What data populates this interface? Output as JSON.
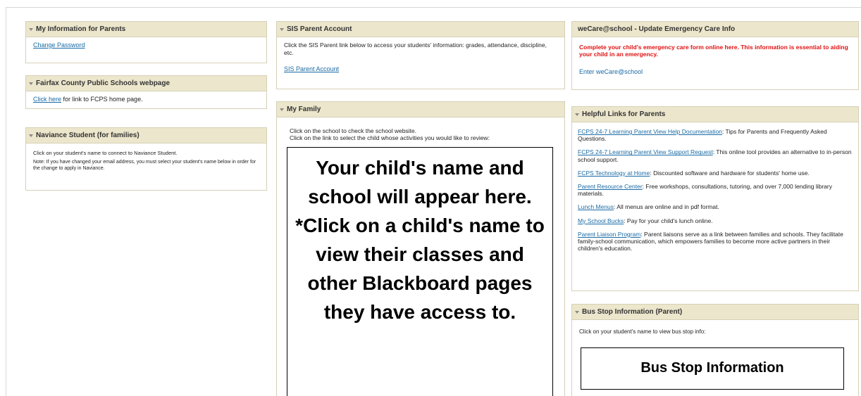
{
  "my_info": {
    "title": "My Information for Parents",
    "change_password": "Change Password"
  },
  "fcps_webpage": {
    "title": "Fairfax County Public Schools webpage",
    "click_here": "Click here",
    "text": " for link to FCPS home page."
  },
  "naviance": {
    "title": "Naviance Student (for families)",
    "line1": "Click on your student's name to connect to Naviance Student.",
    "note": "Note: If you have changed your email address, you must select your student's name below in order for the change to apply in Naviance."
  },
  "sis": {
    "title": "SIS Parent Account",
    "text": "Click the SIS Parent link below to access your students' information: grades, attendance, discipline, etc.",
    "link": "SIS Parent Account"
  },
  "family": {
    "title": "My Family",
    "line1": "Click on the school to check the school website.",
    "line2": "Click on the link to select the child whose activities you would like to review:",
    "overlay": "Your child's name and school will appear here. *Click on a child's name to view their classes and other Blackboard pages they have access to."
  },
  "wecare": {
    "title": "weCare@school - Update Emergency Care Info",
    "red_text": "Complete your child's emergency care form online here. This information is essential to aiding your child in an emergency.",
    "link": "Enter weCare@school"
  },
  "helpful": {
    "title": "Helpful Links for Parents",
    "items": [
      {
        "link": "FCPS 24-7 Learning Parent View Help Documentation",
        "text": ": Tips for Parents and Frequently Asked Questions."
      },
      {
        "link": "FCPS 24-7 Learning Parent View Support Request",
        "text": ": This online tool provides an alternative to in-person school support."
      },
      {
        "link": "FCPS Technology at Home",
        "text": ": Discounted software and hardware for students' home use."
      },
      {
        "link": "Parent Resource Center",
        "text": ": Free workshops, consultations, tutoring, and over 7,000 lending library materials."
      },
      {
        "link": "Lunch Menus",
        "text": ": All menus are online and in pdf format."
      },
      {
        "link": "My School Bucks",
        "text": ": Pay for your child's lunch online."
      },
      {
        "link": "Parent Liaison Program",
        "text": ": Parent liaisons serve as a link between families and schools. They facilitate family-school communication, which empowers families to become more active partners in their children's education."
      }
    ]
  },
  "bus": {
    "title": "Bus Stop Information (Parent)",
    "text": "Click on your student's name to view bus stop info:",
    "overlay": "Bus Stop Information"
  }
}
